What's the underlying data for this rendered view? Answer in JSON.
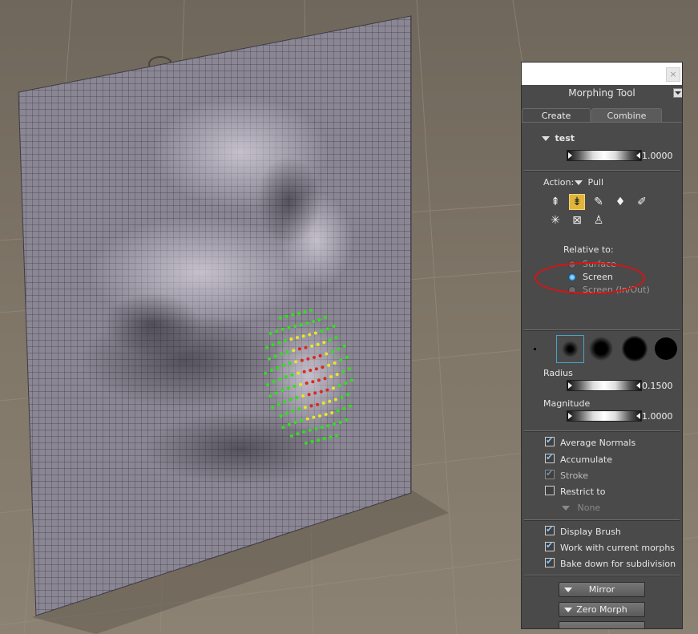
{
  "panel": {
    "title": "Morphing Tool",
    "close_icon": "close-icon",
    "tabs": [
      {
        "label": "Create",
        "active": true
      },
      {
        "label": "Combine",
        "active": false
      }
    ],
    "morph": {
      "name": "test",
      "value": "1.0000"
    },
    "action": {
      "label": "Action:",
      "value": "Pull"
    },
    "tools": [
      "push-icon",
      "pull-icon",
      "brush-icon",
      "smooth-icon",
      "eraser-icon",
      "pinch-icon",
      "flatten-icon",
      "sculpt-icon"
    ],
    "relative": {
      "label": "Relative to:",
      "options": [
        {
          "label": "Surface",
          "selected": false
        },
        {
          "label": "Screen",
          "selected": true
        },
        {
          "label": "Screen (In/Out)",
          "selected": false
        }
      ]
    },
    "radius": {
      "label": "Radius",
      "value": "0.1500"
    },
    "magnitude": {
      "label": "Magnitude",
      "value": "1.0000"
    },
    "checkboxes1": [
      {
        "label": "Average Normals",
        "checked": true
      },
      {
        "label": "Accumulate",
        "checked": true
      },
      {
        "label": "Stroke",
        "checked": true,
        "disabled": true
      },
      {
        "label": "Restrict to",
        "checked": false
      }
    ],
    "restrict_value": "None",
    "checkboxes2": [
      {
        "label": "Display Brush",
        "checked": true
      },
      {
        "label": "Work with current morphs",
        "checked": true
      },
      {
        "label": "Bake down for subdivision",
        "checked": true
      }
    ],
    "buttons": [
      {
        "label": "Mirror"
      },
      {
        "label": "Zero Morph"
      }
    ]
  },
  "colors": {
    "panel_bg": "#4a4a4a",
    "accent_active_tool": "#e2b53a",
    "checkbox_check": "#7fc4ff",
    "annotation": "#e01010",
    "mesh": "#8c8794",
    "floor": "#7d7466",
    "point_green": "#33dd22",
    "point_yellow": "#e6e62a",
    "point_red": "#d82a1a"
  }
}
